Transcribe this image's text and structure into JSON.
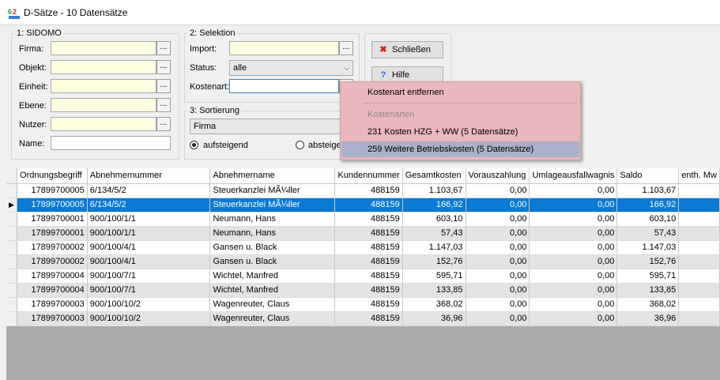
{
  "window": {
    "title": "D-Sätze - 10 Datensätze"
  },
  "sidomo": {
    "title": "1: SIDOMO",
    "fields": [
      {
        "label": "Firma:",
        "value": ""
      },
      {
        "label": "Objekt:",
        "value": ""
      },
      {
        "label": "Einheit:",
        "value": ""
      },
      {
        "label": "Ebene:",
        "value": ""
      },
      {
        "label": "Nutzer:",
        "value": ""
      },
      {
        "label": "Name:",
        "value": ""
      }
    ],
    "ellipsis": "..."
  },
  "selektion": {
    "title": "2: Selektion",
    "import_label": "Import:",
    "import_value": "",
    "status_label": "Status:",
    "status_value": "alle",
    "kostenart_label": "Kostenart:",
    "kostenart_value": "",
    "ellipsis": "..."
  },
  "sortierung": {
    "title": "3: Sortierung",
    "value": "Firma",
    "asc_label": "aufsteigend",
    "desc_label": "absteige",
    "selected": "asc"
  },
  "buttons": {
    "close_label": "Schließen",
    "help_label": "Hilfe"
  },
  "context_menu": {
    "items": [
      {
        "label": "Kostenart entfernen",
        "state": "normal"
      },
      {
        "label": "Kostenarten",
        "state": "disabled"
      },
      {
        "label": "231 Kosten HZG + WW (5 Datensätze)",
        "state": "normal"
      },
      {
        "label": "259 Weitere Betriebskosten (5 Datensätze)",
        "state": "hover"
      }
    ]
  },
  "table": {
    "columns": [
      "Ordnungsbegriff",
      "Abnehmernummer",
      "Abnehmername",
      "Kundennummer",
      "Gesamtkosten",
      "Vorauszahlung",
      "Umlageausfallwagnis",
      "Saldo",
      "enth. Mw"
    ],
    "selected_row": 1,
    "rows": [
      [
        "17899700005",
        "6/134/5/2",
        "Steuerkanzlei MÃ¼ller",
        "488159",
        "1.103,67",
        "0,00",
        "0,00",
        "1.103,67",
        ""
      ],
      [
        "17899700005",
        "6/134/5/2",
        "Steuerkanzlei MÃ¼ller",
        "488159",
        "166,92",
        "0,00",
        "0,00",
        "166,92",
        ""
      ],
      [
        "17899700001",
        "900/100/1/1",
        "Neumann, Hans",
        "488159",
        "603,10",
        "0,00",
        "0,00",
        "603,10",
        ""
      ],
      [
        "17899700001",
        "900/100/1/1",
        "Neumann, Hans",
        "488159",
        "57,43",
        "0,00",
        "0,00",
        "57,43",
        ""
      ],
      [
        "17899700002",
        "900/100/4/1",
        "Gansen u. Black",
        "488159",
        "1.147,03",
        "0,00",
        "0,00",
        "1.147,03",
        ""
      ],
      [
        "17899700002",
        "900/100/4/1",
        "Gansen u. Black",
        "488159",
        "152,76",
        "0,00",
        "0,00",
        "152,76",
        ""
      ],
      [
        "17899700004",
        "900/100/7/1",
        "Wichtel, Manfred",
        "488159",
        "595,71",
        "0,00",
        "0,00",
        "595,71",
        ""
      ],
      [
        "17899700004",
        "900/100/7/1",
        "Wichtel, Manfred",
        "488159",
        "133,85",
        "0,00",
        "0,00",
        "133,85",
        ""
      ],
      [
        "17899700003",
        "900/100/10/2",
        "Wagenreuter, Claus",
        "488159",
        "368,02",
        "0,00",
        "0,00",
        "368,02",
        ""
      ],
      [
        "17899700003",
        "900/100/10/2",
        "Wagenreuter, Claus",
        "488159",
        "36,96",
        "0,00",
        "0,00",
        "36,96",
        ""
      ]
    ]
  },
  "colors": {
    "selection": "#0a7ad4",
    "menu_bg": "#e9b7bd",
    "menu_hover": "#aab0c9",
    "required_field": "#ffffe1"
  }
}
